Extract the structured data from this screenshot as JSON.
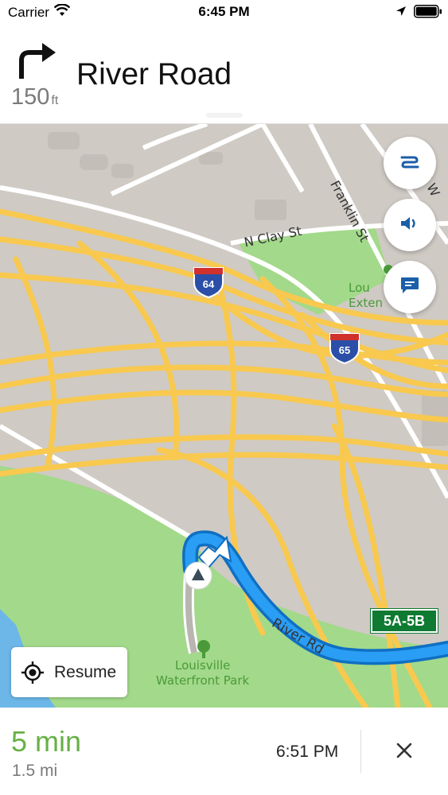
{
  "status_bar": {
    "carrier": "Carrier",
    "time": "6:45 PM"
  },
  "maneuver": {
    "distance_value": "150",
    "distance_unit": "ft",
    "street": "River Road",
    "icon": "turn-right-icon"
  },
  "map": {
    "labels": {
      "n_clay_st": "N Clay St",
      "franklin_st": "Franklin St",
      "e_partial": "E W",
      "louisville_extension": "Lou Exten",
      "river_rd": "River Rd",
      "park_line1": "Louisville",
      "park_line2": "Waterfront Park"
    },
    "shields": {
      "i64": "64",
      "i65": "65"
    },
    "exit_badge": "5A-5B"
  },
  "controls": {
    "route_overview_icon": "route-icon",
    "sound_icon": "speaker-icon",
    "feedback_icon": "chat-icon",
    "resume_label": "Resume"
  },
  "trip": {
    "duration": "5 min",
    "distance": "1.5 mi",
    "arrival": "6:51 PM"
  },
  "colors": {
    "route": "#2a9df4",
    "highway": "#f8c94e",
    "park": "#a3d98a",
    "map_bg": "#cfcac4",
    "duration": "#67b146",
    "exit_sign": "#0e7a32"
  }
}
